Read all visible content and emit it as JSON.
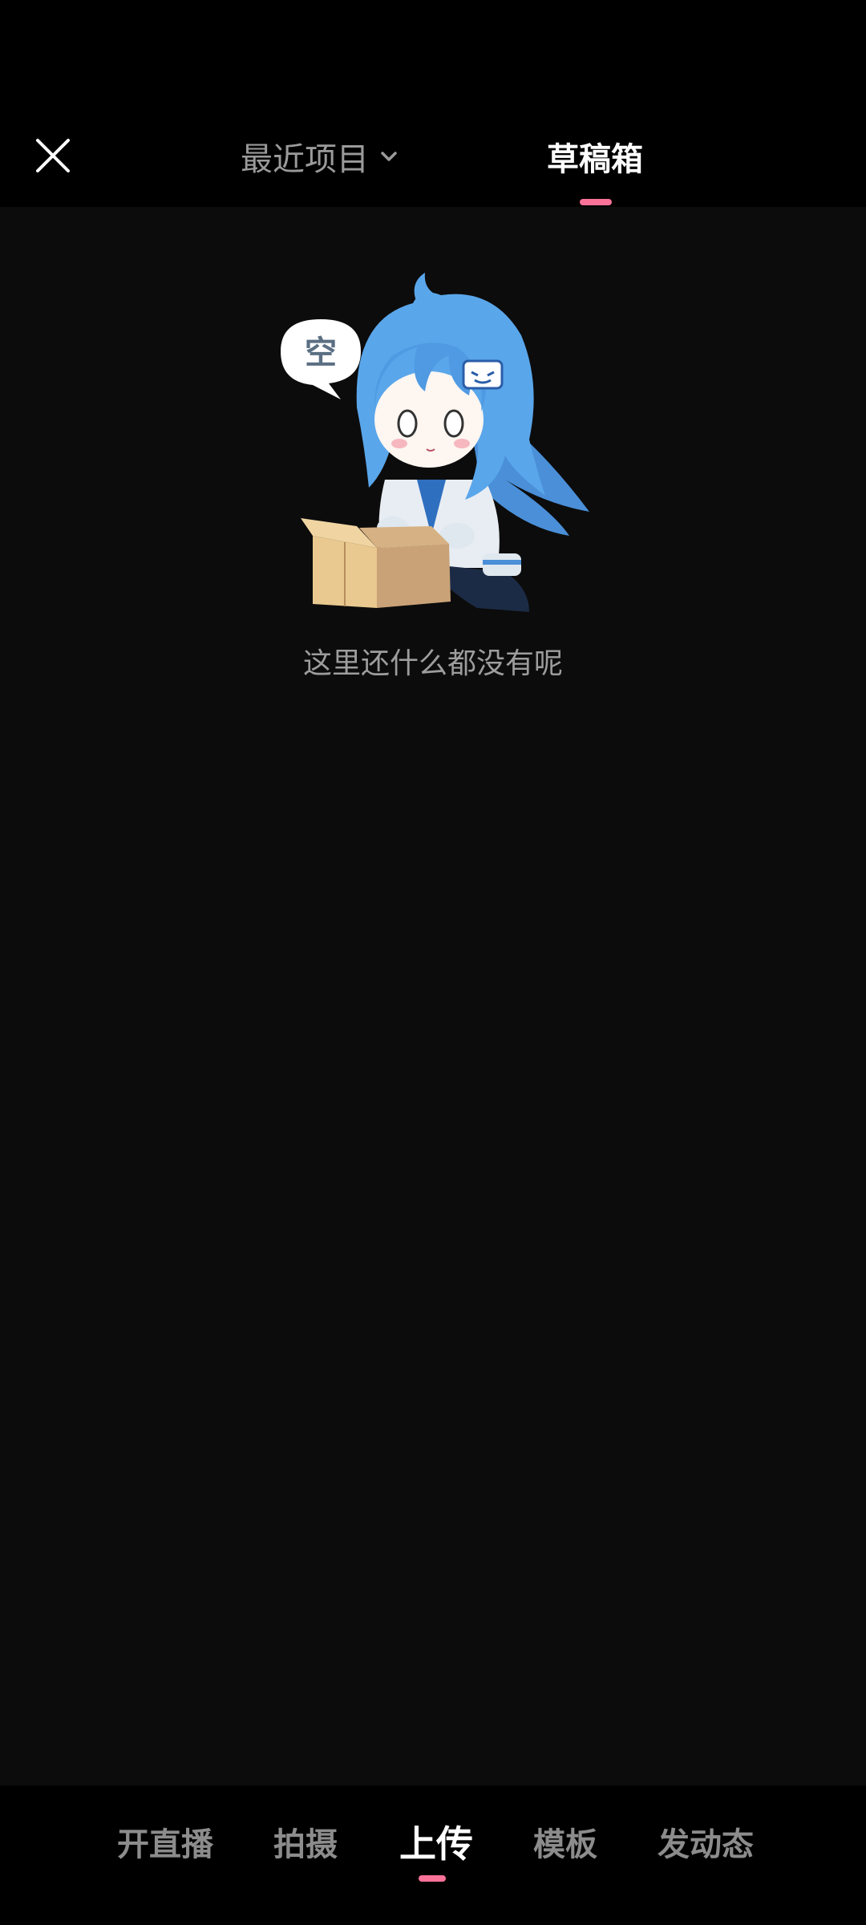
{
  "header": {
    "close_icon": "close-icon",
    "tabs": [
      {
        "label": "最近项目",
        "icon": "chevron-down-icon",
        "active": false
      },
      {
        "label": "草稿箱",
        "active": true
      }
    ],
    "accent_color": "#fb7299"
  },
  "empty_state": {
    "bubble_text": "空",
    "message": "这里还什么都没有呢"
  },
  "bottom_nav": {
    "items": [
      {
        "label": "开直播",
        "active": false
      },
      {
        "label": "拍摄",
        "active": false
      },
      {
        "label": "上传",
        "active": true
      },
      {
        "label": "模板",
        "active": false
      },
      {
        "label": "发动态",
        "active": false
      }
    ]
  }
}
